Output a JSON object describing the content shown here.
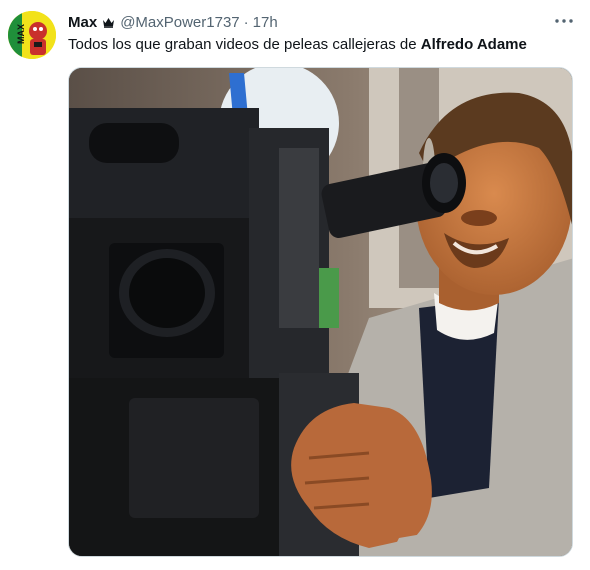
{
  "tweet": {
    "display_name": "Max",
    "handle": "@MaxPower1737",
    "separator": "·",
    "time": "17h",
    "text_plain": "Todos los que graban videos de peleas callejeras de ",
    "text_bold": "Alfredo Adame",
    "avatar_text": "MAX"
  },
  "icons": {
    "badge": "crown-icon",
    "more": "more-horizontal-icon"
  },
  "colors": {
    "text_primary": "#0f1419",
    "text_secondary": "#536471",
    "border": "#cfd9de",
    "avatar_bg": "#f2e21a"
  }
}
